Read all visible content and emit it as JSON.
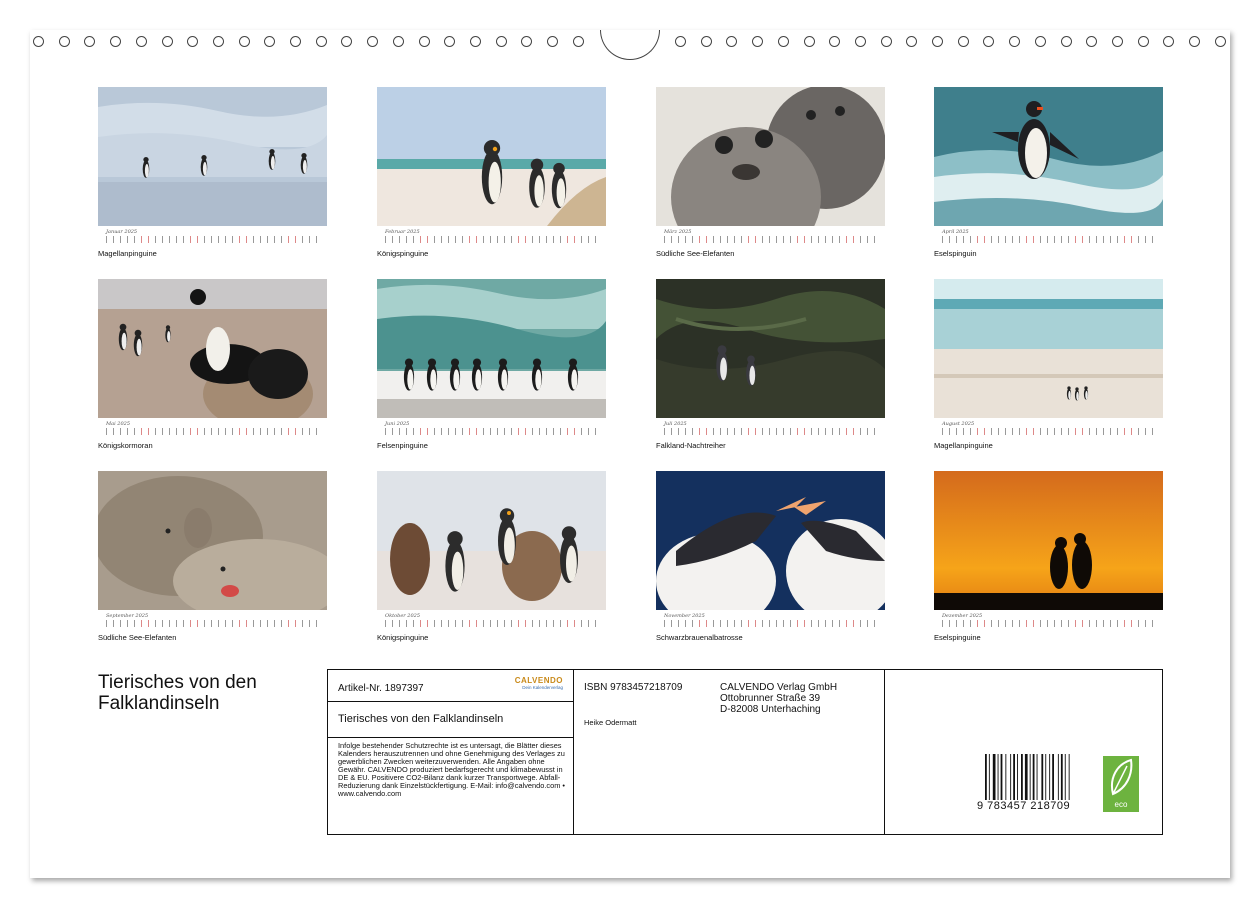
{
  "calendar": {
    "title": "Tierisches von den Falklandinseln",
    "months": [
      {
        "month": "Januar 2025",
        "caption": "Magellanpinguine",
        "scene": "magellan-beach"
      },
      {
        "month": "Februar 2025",
        "caption": "Königspinguine",
        "scene": "king-beach"
      },
      {
        "month": "März 2025",
        "caption": "Südliche See-Elefanten",
        "scene": "seal-pups"
      },
      {
        "month": "April 2025",
        "caption": "Eselspinguin",
        "scene": "gentoo-surf"
      },
      {
        "month": "Mai 2025",
        "caption": "Königskormoran",
        "scene": "cormorant-rock"
      },
      {
        "month": "Juni 2025",
        "caption": "Felsenpinguine",
        "scene": "rockhopper-line"
      },
      {
        "month": "Juli 2025",
        "caption": "Falkland-Nachtreiher",
        "scene": "herons-rock"
      },
      {
        "month": "August 2025",
        "caption": "Magellanpinguine",
        "scene": "magellan-shore"
      },
      {
        "month": "September 2025",
        "caption": "Südliche See-Elefanten",
        "scene": "elephant-seals"
      },
      {
        "month": "Oktober 2025",
        "caption": "Königspinguine",
        "scene": "king-chicks"
      },
      {
        "month": "November 2025",
        "caption": "Schwarzbrauenalbatrosse",
        "scene": "albatross-pair"
      },
      {
        "month": "Dezember 2025",
        "caption": "Eselspinguine",
        "scene": "sunset-silhouette"
      }
    ]
  },
  "info": {
    "artikel": "Artikel-Nr. 1897397",
    "brand_name": "CALVENDO",
    "brand_sub": "Dein Kalenderverlag",
    "subtitle": "Tierisches von den Falklandinseln",
    "legal": "Infolge bestehender Schutzrechte ist es untersagt, die Blätter dieses Kalenders herauszutrennen und ohne Genehmigung des Verlages zu gewerblichen Zwecken weiterzuverwenden. Alle Angaben ohne Gewähr. CALVENDO produziert bedarfsgerecht und klimabewusst in DE & EU. Positivere CO2-Bilanz dank kurzer Transportwege. Abfall-Reduzierung dank Einzelstückfertigung. E-Mail: info@calvendo.com • www.calvendo.com",
    "isbn": "ISBN 9783457218709",
    "author": "Heike Odermatt",
    "publisher_line1": "CALVENDO Verlag GmbH",
    "publisher_line2": "Ottobrunner Straße 39",
    "publisher_line3": "D-82008 Unterhaching",
    "barcode_number": "9   783457   218709",
    "eco_label": "eco"
  },
  "colors": {
    "brand_orange": "#c98a1a",
    "brand_blue": "#3a6fb0",
    "eco_green": "#6db33f"
  }
}
